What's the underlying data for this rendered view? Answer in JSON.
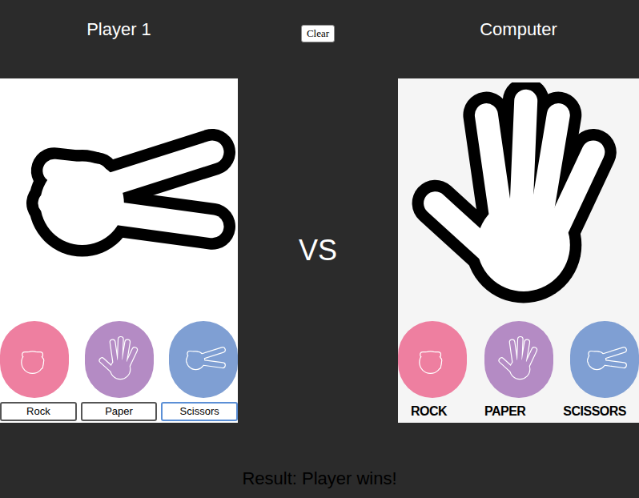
{
  "header": {
    "player_label": "Player 1",
    "clear_button": "Clear",
    "computer_label": "Computer"
  },
  "vs": "VS",
  "player": {
    "options": [
      {
        "label": "Rock",
        "kind": "rock",
        "selected": false,
        "color": "#ee7fa0"
      },
      {
        "label": "Paper",
        "kind": "paper",
        "selected": false,
        "color": "#b48bc4"
      },
      {
        "label": "Scissors",
        "kind": "scissors",
        "selected": true,
        "color": "#7f9fd3"
      }
    ]
  },
  "computer": {
    "options": [
      {
        "label": "ROCK",
        "kind": "rock",
        "selected": false,
        "color": "#ee7fa0"
      },
      {
        "label": "PAPER",
        "kind": "paper",
        "selected": true,
        "color": "#b48bc4"
      },
      {
        "label": "SCISSORS",
        "kind": "scissors",
        "selected": false,
        "color": "#7f9fd3"
      }
    ]
  },
  "result": "Result: Player wins!"
}
